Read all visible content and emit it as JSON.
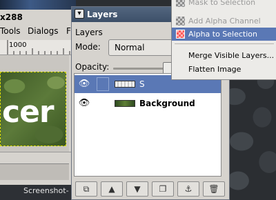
{
  "image_window": {
    "title": "x288",
    "menubar": [
      "Tools",
      "Dialogs",
      "F"
    ],
    "ruler_label": "1000",
    "canvas_text": "cer",
    "taskbar_label": "Screenshot-"
  },
  "layers_dialog": {
    "title": "Layers",
    "heading": "Layers",
    "mode_label": "Mode:",
    "mode_value": "Normal",
    "opacity_label": "Opacity:",
    "layers": [
      {
        "name": "S",
        "selected": true,
        "visible": true
      },
      {
        "name": "Background",
        "selected": false,
        "visible": true
      }
    ],
    "buttons": [
      {
        "icon": "new-layer-icon",
        "glyph": "⧉"
      },
      {
        "icon": "raise-layer-icon",
        "glyph": "▲"
      },
      {
        "icon": "lower-layer-icon",
        "glyph": "▼"
      },
      {
        "icon": "duplicate-layer-icon",
        "glyph": "❐"
      },
      {
        "icon": "anchor-layer-icon",
        "glyph": "⚓"
      },
      {
        "icon": "delete-layer-icon",
        "glyph": "🗑"
      }
    ]
  },
  "context_menu": {
    "items": [
      {
        "label": "Mask to Selection",
        "enabled": false,
        "highlighted": false
      },
      {
        "label": "Add Alpha Channel",
        "enabled": false,
        "highlighted": false
      },
      {
        "label": "Alpha to Selection",
        "enabled": true,
        "highlighted": true
      },
      {
        "label": "Merge Visible Layers...",
        "enabled": true,
        "highlighted": false
      },
      {
        "label": "Flatten Image",
        "enabled": true,
        "highlighted": false
      }
    ]
  },
  "colors": {
    "selection_blue": "#5a78b5",
    "titlebar": "#3d4f68",
    "panel_bg": "#d6d3ce"
  }
}
